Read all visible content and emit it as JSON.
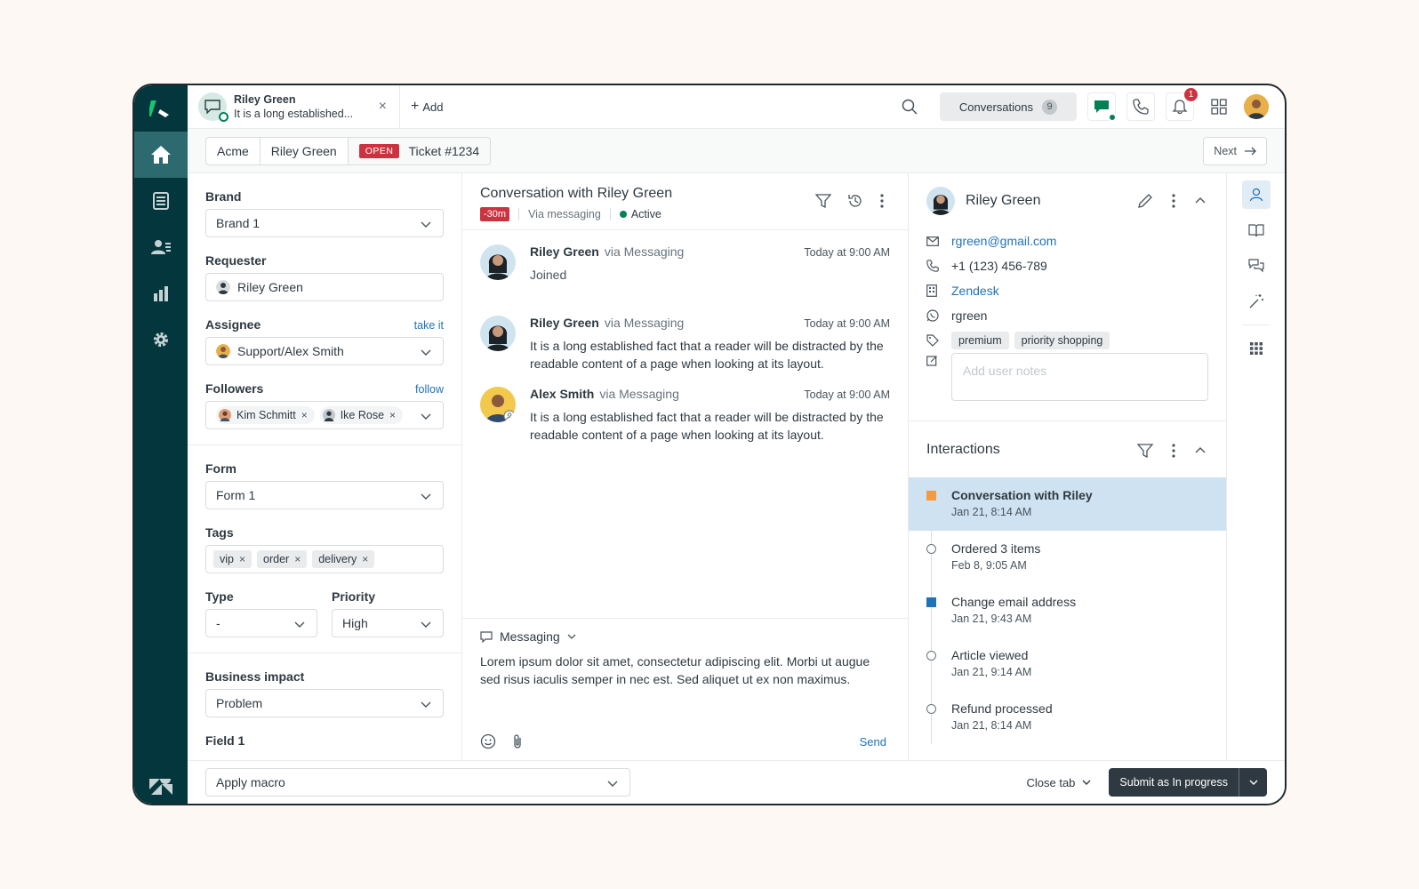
{
  "tab": {
    "name": "Riley Green",
    "preview": "It is a long established...",
    "close": "×",
    "add_label": "Add"
  },
  "topbar": {
    "conversations_label": "Conversations",
    "conversations_count": "9",
    "notifications_count": "1"
  },
  "breadcrumb": {
    "org": "Acme",
    "requester": "Riley Green",
    "status": "OPEN",
    "ticket": "Ticket #1234",
    "next_label": "Next"
  },
  "ticket_fields": {
    "brand_label": "Brand",
    "brand_value": "Brand 1",
    "requester_label": "Requester",
    "requester_value": "Riley Green",
    "assignee_label": "Assignee",
    "assignee_action": "take it",
    "assignee_value": "Support/Alex Smith",
    "followers_label": "Followers",
    "followers_action": "follow",
    "followers": [
      "Kim Schmitt",
      "Ike Rose"
    ],
    "form_label": "Form",
    "form_value": "Form 1",
    "tags_label": "Tags",
    "tags": [
      "vip",
      "order",
      "delivery"
    ],
    "type_label": "Type",
    "type_value": "-",
    "priority_label": "Priority",
    "priority_value": "High",
    "impact_label": "Business impact",
    "impact_value": "Problem",
    "field1_label": "Field 1"
  },
  "conversation": {
    "title": "Conversation with Riley Green",
    "sla": "-30m",
    "channel": "Via messaging",
    "status": "Active",
    "messages": [
      {
        "author": "Riley Green",
        "via": "via Messaging",
        "time": "Today at 9:00 AM",
        "body": "Joined"
      },
      {
        "author": "Riley Green",
        "via": "via Messaging",
        "time": "Today at 9:00 AM",
        "body": "It is a long established fact that a reader will be distracted by the readable content of a page when looking at its layout."
      },
      {
        "author": "Alex Smith",
        "via": "via Messaging",
        "time": "Today at 9:00 AM",
        "body": "It is a long established fact that a reader will be distracted by the readable content of a page when looking at its layout."
      }
    ]
  },
  "composer": {
    "channel": "Messaging",
    "text": "Lorem ipsum dolor sit amet, consectetur adipiscing elit. Morbi ut augue sed risus iaculis semper in nec est. Sed aliquet ut ex non maximus.",
    "send_label": "Send"
  },
  "user": {
    "name": "Riley Green",
    "email": "rgreen@gmail.com",
    "phone": "+1 (123) 456-789",
    "org": "Zendesk",
    "whatsapp": "rgreen",
    "tags": [
      "premium",
      "priority shopping"
    ],
    "notes_placeholder": "Add user notes"
  },
  "interactions": {
    "title": "Interactions",
    "items": [
      {
        "title": "Conversation with Riley",
        "date": "Jan 21, 8:14 AM"
      },
      {
        "title": "Ordered 3 items",
        "date": "Feb 8, 9:05 AM"
      },
      {
        "title": "Change email address",
        "date": "Jan 21, 9:43 AM"
      },
      {
        "title": "Article viewed",
        "date": "Jan 21, 9:14 AM"
      },
      {
        "title": "Refund processed",
        "date": "Jan 21, 8:14 AM"
      }
    ]
  },
  "bottombar": {
    "macro_label": "Apply macro",
    "close_tab_label": "Close tab",
    "submit_label": "Submit as In progress"
  },
  "colors": {
    "rail": "#03363d",
    "accent_red": "#cc3340",
    "link_blue": "#1f73b7",
    "active_green": "#038153",
    "selected_row": "#cee2f2"
  }
}
